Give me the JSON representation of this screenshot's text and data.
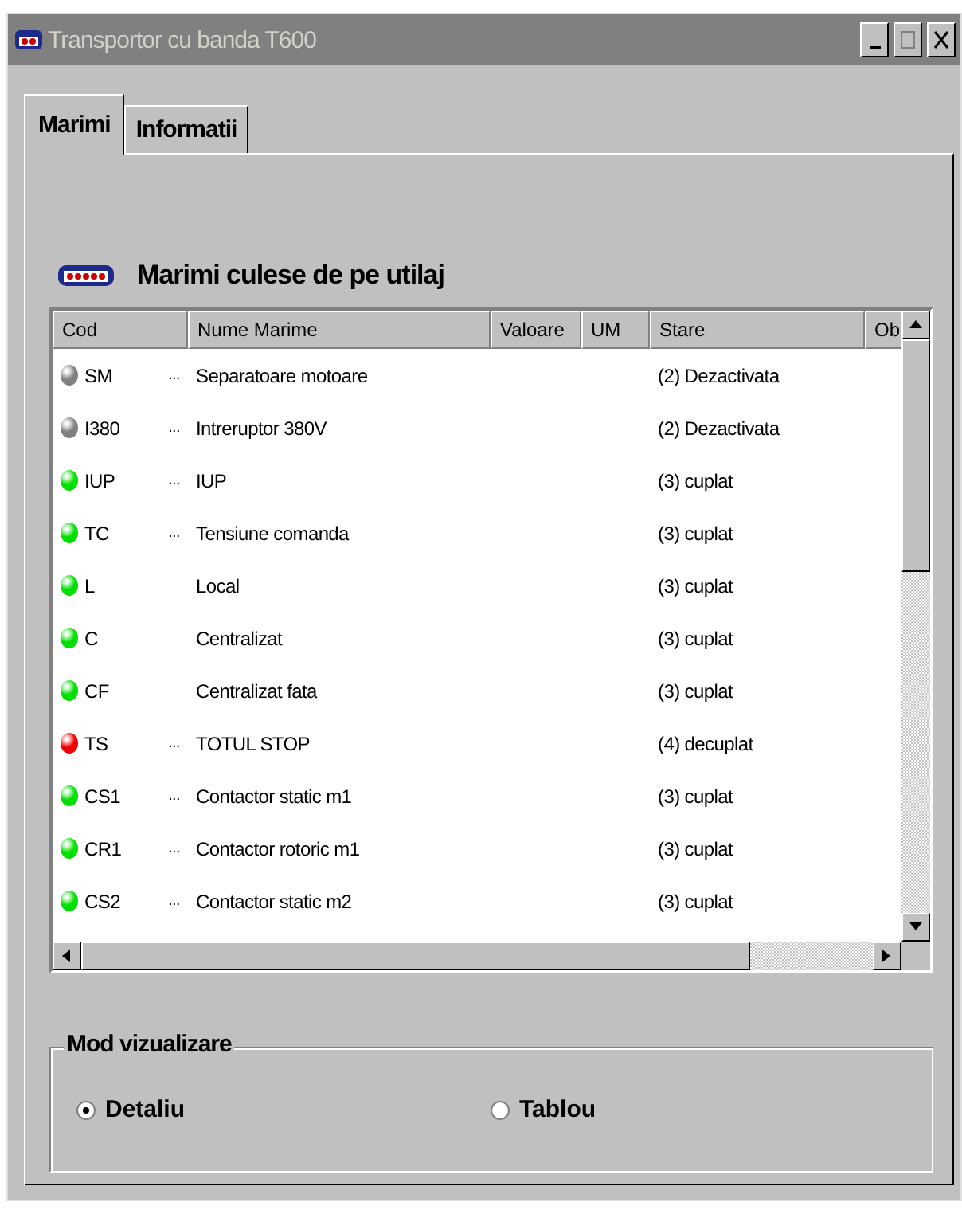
{
  "window": {
    "title": "Transportor cu banda T600"
  },
  "tabs": [
    {
      "label": "Marimi",
      "selected": true
    },
    {
      "label": "Informatii",
      "selected": false
    }
  ],
  "section": {
    "title": "Marimi culese de pe utilaj"
  },
  "table": {
    "columns": [
      "Cod",
      "Nume Marime",
      "Valoare",
      "UM",
      "Stare",
      "Ob"
    ],
    "rows": [
      {
        "color": "#808080",
        "code": "SM",
        "more": "...",
        "name": "Separatoare motoare",
        "state": "(2) Dezactivata"
      },
      {
        "color": "#808080",
        "code": "I380",
        "more": "...",
        "name": "Intreruptor 380V",
        "state": "(2) Dezactivata"
      },
      {
        "color": "#00e000",
        "code": "IUP",
        "more": "...",
        "name": "IUP",
        "state": "(3) cuplat"
      },
      {
        "color": "#00e000",
        "code": "TC",
        "more": "...",
        "name": "Tensiune comanda",
        "state": "(3) cuplat"
      },
      {
        "color": "#00e000",
        "code": "L",
        "name": "Local",
        "state": "(3) cuplat"
      },
      {
        "color": "#00e000",
        "code": "C",
        "name": "Centralizat",
        "state": "(3) cuplat"
      },
      {
        "color": "#00e000",
        "code": "CF",
        "name": "Centralizat fata",
        "state": "(3) cuplat"
      },
      {
        "color": "#f00000",
        "code": "TS",
        "more": "...",
        "name": "TOTUL STOP",
        "state": "(4) decuplat"
      },
      {
        "color": "#00e000",
        "code": "CS1",
        "more": "...",
        "name": "Contactor static m1",
        "state": "(3) cuplat"
      },
      {
        "color": "#00e000",
        "code": "CR1",
        "more": "...",
        "name": "Contactor rotoric m1",
        "state": "(3) cuplat"
      },
      {
        "color": "#00e000",
        "code": "CS2",
        "more": "...",
        "name": "Contactor static m2",
        "state": "(3) cuplat"
      }
    ]
  },
  "view_mode": {
    "title": "Mod vizualizare",
    "options": [
      {
        "label": "Detaliu",
        "selected": true
      },
      {
        "label": "Tablou",
        "selected": false
      }
    ]
  }
}
